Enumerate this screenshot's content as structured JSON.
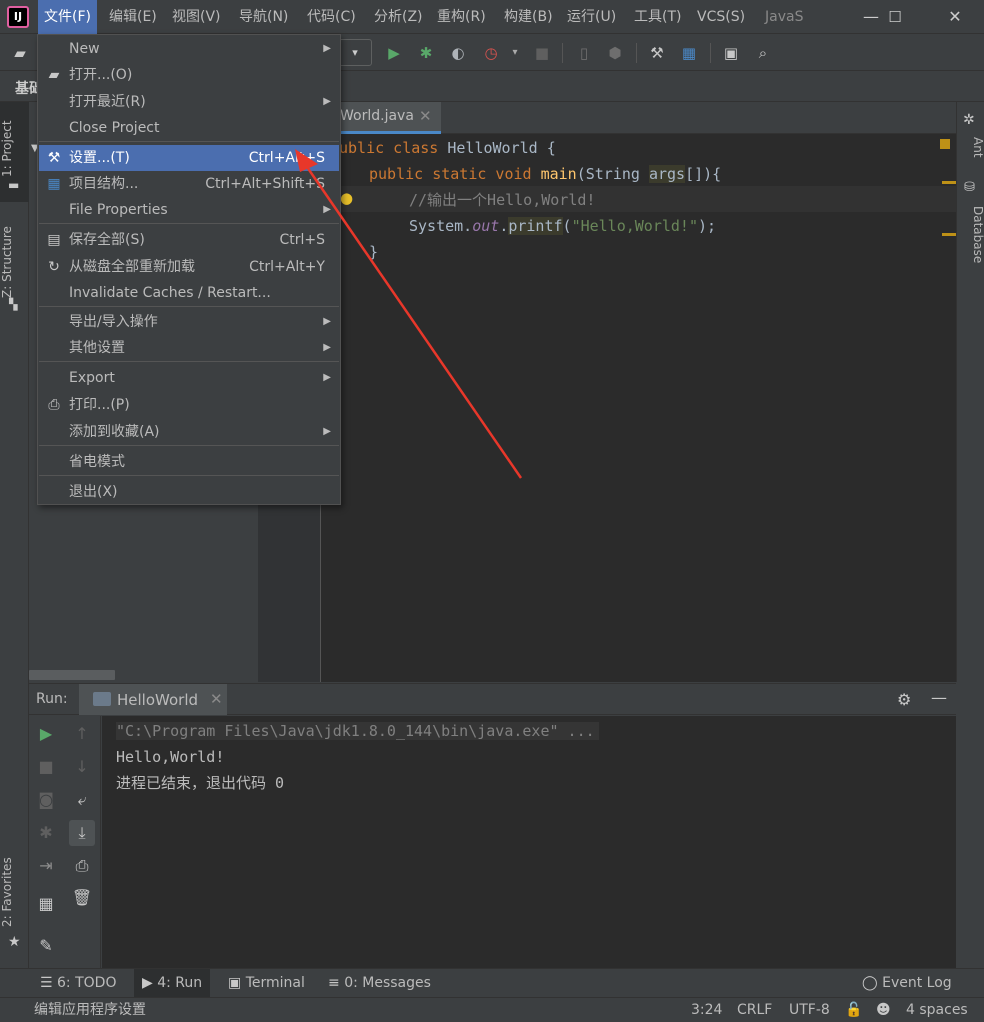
{
  "app": {
    "logo_text": "IJ",
    "window_title_fragment": "JavaS"
  },
  "menubar": {
    "items": [
      "文件(F)",
      "编辑(E)",
      "视图(V)",
      "导航(N)",
      "代码(C)",
      "分析(Z)",
      "重构(R)",
      "构建(B)",
      "运行(U)",
      "工具(T)",
      "VCS(S)"
    ]
  },
  "window_controls": {
    "minimize": "—",
    "maximize": "☐",
    "close": "✕"
  },
  "navbar": {
    "breadcrumb_fragment": "基础"
  },
  "left_tool_tabs": {
    "project": "1: Project",
    "structure": "Z: Structure",
    "favorites": "2: Favorites"
  },
  "right_tool_tabs": {
    "ant": "Ant",
    "database": "Database"
  },
  "file_menu": {
    "items": [
      {
        "label": "New",
        "shortcut": "",
        "submenu": true,
        "icon": ""
      },
      {
        "label": "打开...(O)",
        "shortcut": "",
        "submenu": false,
        "icon": "folder-open-icon"
      },
      {
        "label": "打开最近(R)",
        "shortcut": "",
        "submenu": true,
        "icon": ""
      },
      {
        "label": "Close Project",
        "shortcut": "",
        "submenu": false,
        "icon": ""
      },
      {
        "label": "设置...(T)",
        "shortcut": "Ctrl+Alt+S",
        "submenu": false,
        "icon": "wrench-icon",
        "selected": true
      },
      {
        "label": "项目结构...",
        "shortcut": "Ctrl+Alt+Shift+S",
        "submenu": false,
        "icon": "project-structure-icon"
      },
      {
        "label": "File Properties",
        "shortcut": "",
        "submenu": true,
        "icon": ""
      },
      {
        "label": "保存全部(S)",
        "shortcut": "Ctrl+S",
        "submenu": false,
        "icon": "save-icon"
      },
      {
        "label": "从磁盘全部重新加载",
        "shortcut": "Ctrl+Alt+Y",
        "submenu": false,
        "icon": "reload-icon"
      },
      {
        "label": "Invalidate Caches / Restart...",
        "shortcut": "",
        "submenu": false,
        "icon": ""
      },
      {
        "label": "导出/导入操作",
        "shortcut": "",
        "submenu": true,
        "icon": ""
      },
      {
        "label": "其他设置",
        "shortcut": "",
        "submenu": true,
        "icon": ""
      },
      {
        "label": "Export",
        "shortcut": "",
        "submenu": true,
        "icon": ""
      },
      {
        "label": "打印...(P)",
        "shortcut": "",
        "submenu": false,
        "icon": "print-icon"
      },
      {
        "label": "添加到收藏(A)",
        "shortcut": "",
        "submenu": true,
        "icon": ""
      },
      {
        "label": "省电模式",
        "shortcut": "",
        "submenu": false,
        "icon": ""
      },
      {
        "label": "退出(X)",
        "shortcut": "",
        "submenu": false,
        "icon": ""
      }
    ]
  },
  "editor": {
    "tab_label": "World.java",
    "lines": {
      "l1_kw": "ublic class ",
      "l1_rest": "HelloWorld {",
      "l2_kw": "public static void ",
      "l2_fn": "main",
      "l2_a": "(String ",
      "l2_arg": "args",
      "l2_b": "[]){",
      "l3_cmt": "//输出一个Hello,World!",
      "l4_a": "System.",
      "l4_out": "out",
      "l4_dot": ".",
      "l4_fn": "printf",
      "l4_p1": "(",
      "l4_str": "\"Hello,World!\"",
      "l4_p2": ");",
      "l5": "}"
    }
  },
  "run_panel": {
    "label": "Run:",
    "tab_label": "HelloWorld",
    "console": [
      "\"C:\\Program Files\\Java\\jdk1.8.0_144\\bin\\java.exe\" ...",
      "Hello,World!",
      "进程已结束，退出代码 0"
    ]
  },
  "bottom_tabs": {
    "todo": "6: TODO",
    "run": "4: Run",
    "terminal": "Terminal",
    "messages": "0: Messages",
    "event_log": "Event Log"
  },
  "status_bar": {
    "message": "编辑应用程序设置",
    "position": "3:24",
    "line_sep": "CRLF",
    "encoding": "UTF-8",
    "indent": "4 spaces"
  },
  "colors": {
    "selection": "#4b6eaf",
    "background": "#3c3f41",
    "editor_bg": "#2b2b2b",
    "keyword": "#cc7832",
    "string": "#6a8759",
    "annotation_arrow": "#e8372a"
  }
}
